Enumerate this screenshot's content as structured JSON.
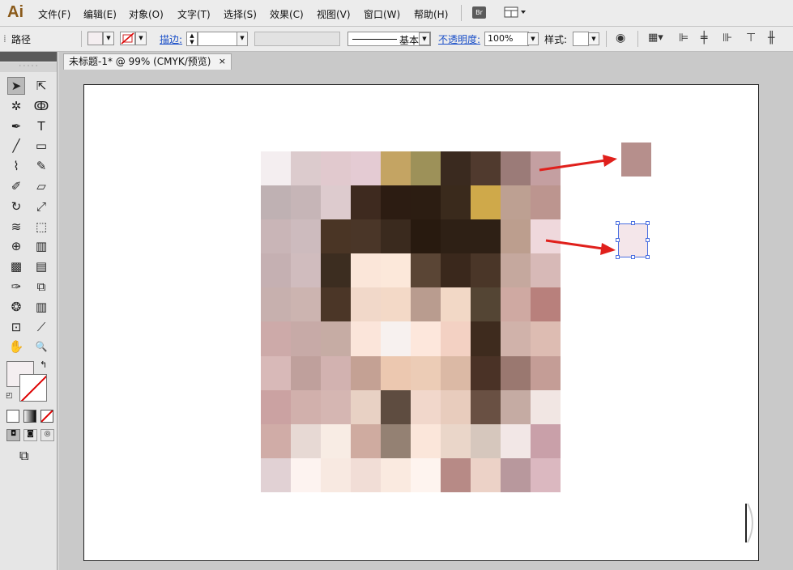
{
  "app": {
    "logo": "Ai"
  },
  "menu": {
    "items": [
      "文件(F)",
      "编辑(E)",
      "对象(O)",
      "文字(T)",
      "选择(S)",
      "效果(C)",
      "视图(V)",
      "窗口(W)",
      "帮助(H)"
    ],
    "bridge": "Br"
  },
  "control": {
    "object_type": "路径",
    "stroke_label": "描边:",
    "stroke_profile": "基本",
    "opacity_label": "不透明度:",
    "opacity_value": "100%",
    "style_label": "样式:"
  },
  "document": {
    "tab_title": "未标题-1* @ 99% (CMYK/预览)",
    "close": "×"
  },
  "tools": [
    "selection-tool",
    "direct-selection-tool",
    "magic-wand-tool",
    "lasso-tool",
    "pen-tool",
    "type-tool",
    "line-tool",
    "rectangle-tool",
    "paintbrush-tool",
    "pencil-tool",
    "blob-brush-tool",
    "eraser-tool",
    "rotate-tool",
    "scale-tool",
    "warp-tool",
    "free-transform-tool",
    "shape-builder-tool",
    "perspective-grid-tool",
    "mesh-tool",
    "gradient-tool",
    "eyedropper-tool",
    "blend-tool",
    "symbol-sprayer-tool",
    "column-graph-tool",
    "artboard-tool",
    "slice-tool",
    "hand-tool",
    "zoom-tool"
  ],
  "mosaic_colors": [
    [
      "#f4eef0",
      "#dccbcd",
      "#e1c9ce",
      "#e4cbd3",
      "#c4a463",
      "#9d9159",
      "#3a2a1f",
      "#503a2e",
      "#9b7b78",
      "#c49fa1"
    ],
    [
      "#bfb1b3",
      "#c6b5b7",
      "#ddcbce",
      "#3e2a1f",
      "#2c1c12",
      "#2c1d12",
      "#3a2a1c",
      "#cfa94a",
      "#bda092",
      "#bc958f"
    ],
    [
      "#c9b5b7",
      "#cdbbbe",
      "#4a3525",
      "#4a3628",
      "#3a2a1e",
      "#281a0f",
      "#2e2015",
      "#2e2015",
      "#bc9e8e",
      "#efd8dc"
    ],
    [
      "#c5b0b2",
      "#d0bcbe",
      "#3c2d20",
      "#fbe6d9",
      "#fce8da",
      "#5a4535",
      "#3a281c",
      "#4a3628",
      "#c5a89e",
      "#d7b9b7"
    ],
    [
      "#c7b0ae",
      "#ccb4b0",
      "#4b3627",
      "#f1d8c9",
      "#f3d9c7",
      "#b99c8f",
      "#f2d8c6",
      "#544534",
      "#cfa9a2",
      "#b8807c"
    ],
    [
      "#cdaaa9",
      "#c7aaa7",
      "#c6aca4",
      "#fbe5da",
      "#f7f1ef",
      "#fde7dc",
      "#f3d1c3",
      "#3e2b1e",
      "#d0b2aa",
      "#ddbcb2"
    ],
    [
      "#d8b9b8",
      "#bfa09c",
      "#d2b2b0",
      "#c4a194",
      "#ecc8b0",
      "#ecccb6",
      "#dbb9a5",
      "#4a3226",
      "#9a7870",
      "#c49d96"
    ],
    [
      "#cba2a2",
      "#d1b0ac",
      "#d5b6b2",
      "#e8d1c4",
      "#5e4c40",
      "#f1d7cb",
      "#e8ccbd",
      "#695043",
      "#c5aba3",
      "#f1e6e3"
    ],
    [
      "#d0aca7",
      "#e7d9d4",
      "#f8ece4",
      "#cfaba0",
      "#948173",
      "#fbe6da",
      "#ead6c9",
      "#d6c7bd",
      "#f2e7e6",
      "#c9a0a9"
    ],
    [
      "#e1d1d4",
      "#fdf3f0",
      "#f8e9e1",
      "#f1ddd6",
      "#faeae0",
      "#fef4ef",
      "#b78a86",
      "#ecd2c7",
      "#b8989d",
      "#dbb8c0"
    ]
  ],
  "swatches": {
    "top_color": "#b68f8c",
    "selected_color": "#f4e6ea"
  },
  "colors": {
    "fill": "#f4eef0",
    "arrow": "#e0201c",
    "selection": "#4a6fe0"
  }
}
